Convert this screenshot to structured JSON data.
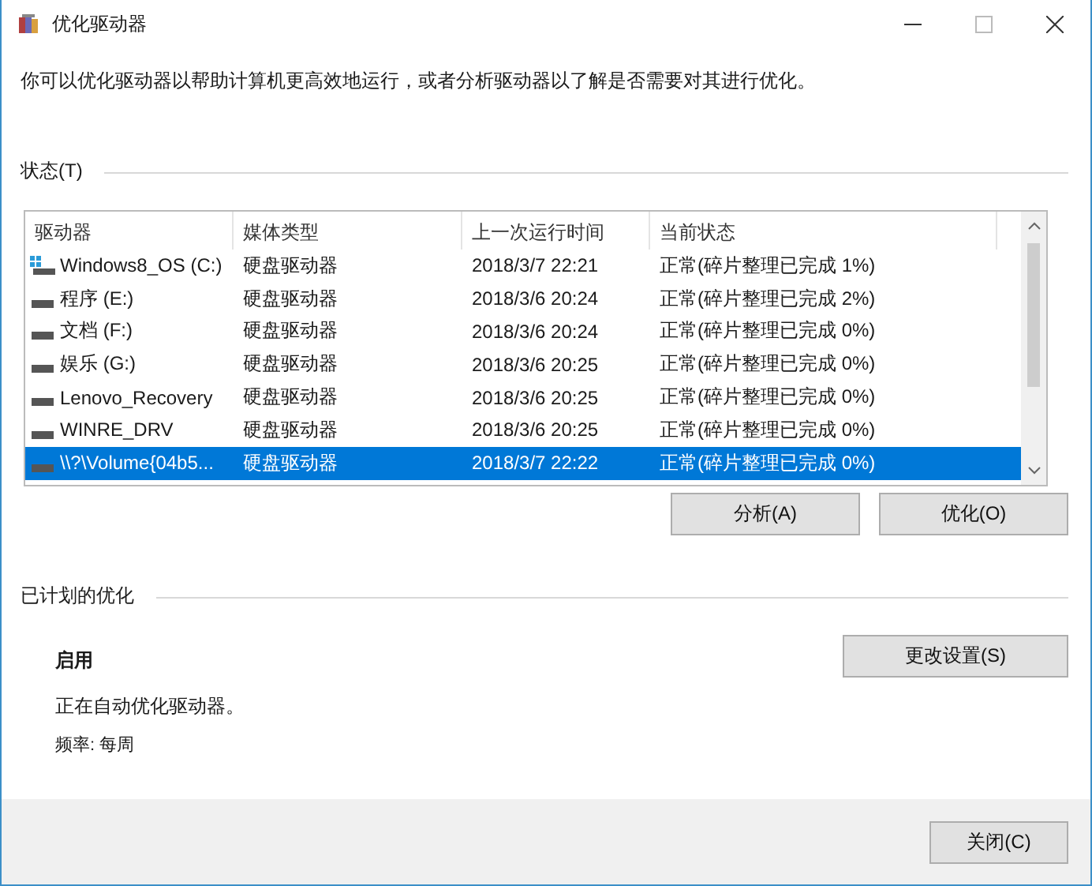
{
  "window": {
    "title": "优化驱动器"
  },
  "description": "你可以优化驱动器以帮助计算机更高效地运行，或者分析驱动器以了解是否需要对其进行优化。",
  "status_section": {
    "title": "状态(T)"
  },
  "table": {
    "columns": [
      "驱动器",
      "媒体类型",
      "上一次运行时间",
      "当前状态"
    ],
    "rows": [
      {
        "drive": "Windows8_OS (C:)",
        "kind": "system",
        "media": "硬盘驱动器",
        "last_run": "2018/3/7 22:21",
        "status": "正常(碎片整理已完成 1%)",
        "selected": false
      },
      {
        "drive": "程序 (E:)",
        "kind": "drive",
        "media": "硬盘驱动器",
        "last_run": "2018/3/6 20:24",
        "status": "正常(碎片整理已完成 2%)",
        "selected": false
      },
      {
        "drive": "文档 (F:)",
        "kind": "drive",
        "media": "硬盘驱动器",
        "last_run": "2018/3/6 20:24",
        "status": "正常(碎片整理已完成 0%)",
        "selected": false
      },
      {
        "drive": "娱乐 (G:)",
        "kind": "drive",
        "media": "硬盘驱动器",
        "last_run": "2018/3/6 20:25",
        "status": "正常(碎片整理已完成 0%)",
        "selected": false
      },
      {
        "drive": "Lenovo_Recovery",
        "kind": "drive",
        "media": "硬盘驱动器",
        "last_run": "2018/3/6 20:25",
        "status": "正常(碎片整理已完成 0%)",
        "selected": false
      },
      {
        "drive": "WINRE_DRV",
        "kind": "drive",
        "media": "硬盘驱动器",
        "last_run": "2018/3/6 20:25",
        "status": "正常(碎片整理已完成 0%)",
        "selected": false
      },
      {
        "drive": "\\\\?\\Volume{04b5...",
        "kind": "drive",
        "media": "硬盘驱动器",
        "last_run": "2018/3/7 22:22",
        "status": "正常(碎片整理已完成 0%)",
        "selected": true
      }
    ]
  },
  "actions": [
    "分析(A)",
    "优化(O)"
  ],
  "scheduled": {
    "title": "已计划的优化",
    "state": "启用",
    "note": "正在自动优化驱动器。",
    "frequency": "频率: 每周",
    "button": "更改设置(S)"
  },
  "footer": {
    "button": "关闭(C)"
  }
}
